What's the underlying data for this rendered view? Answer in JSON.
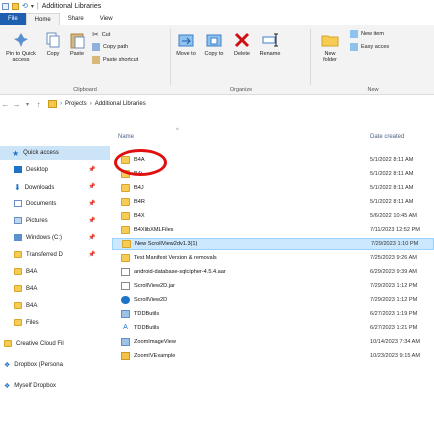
{
  "window": {
    "title": "Additional Libraries"
  },
  "ribbon_tabs": [
    "File",
    "Home",
    "Share",
    "View"
  ],
  "ribbon": {
    "clipboard": {
      "label": "Clipboard",
      "pin_to_quick_access": "Pin to Quick access",
      "copy": "Copy",
      "paste": "Paste",
      "cut": "Cut",
      "copy_path": "Copy path",
      "paste_shortcut": "Paste shortcut"
    },
    "organize": {
      "label": "Organize",
      "move_to": "Move to",
      "copy_to": "Copy to",
      "delete": "Delete",
      "rename": "Rename"
    },
    "new": {
      "label": "New",
      "new_folder": "New folder",
      "new_item": "New item",
      "easy_access": "Easy acces"
    }
  },
  "address": {
    "crumbs": [
      "Projects",
      "Additional Libraries"
    ]
  },
  "nav": [
    {
      "label": "Quick access",
      "icon": "star-icon",
      "color": "#1e73c8"
    },
    {
      "label": "Desktop",
      "icon": "desktop-icon",
      "color": "#1e73c8"
    },
    {
      "label": "Downloads",
      "icon": "download-icon",
      "color": "#1e73c8"
    },
    {
      "label": "Documents",
      "icon": "document-icon",
      "color": "#6b8fbf"
    },
    {
      "label": "Pictures",
      "icon": "picture-icon",
      "color": "#6b8fbf"
    },
    {
      "label": "Windows (C:)",
      "icon": "drive-icon",
      "color": "#5a8fd0"
    },
    {
      "label": "Transferred D",
      "icon": "folder-icon",
      "color": "#f6cc55"
    },
    {
      "label": "B4A",
      "icon": "folder-icon",
      "color": "#f6cc55"
    },
    {
      "label": "B4A",
      "icon": "folder-icon",
      "color": "#f6cc55"
    },
    {
      "label": "B4A",
      "icon": "folder-icon",
      "color": "#f6cc55"
    },
    {
      "label": "Files",
      "icon": "folder-icon",
      "color": "#f6cc55"
    },
    {
      "label": "Creative Cloud Fil",
      "icon": "folder-icon",
      "color": "#f6cc55"
    },
    {
      "label": "Dropbox (Persona",
      "icon": "dropbox-icon",
      "color": "#1e73c8"
    },
    {
      "label": "Myself Dropbox",
      "icon": "dropbox-icon",
      "color": "#1e73c8"
    }
  ],
  "columns": {
    "name": "Name",
    "date_created": "Date created"
  },
  "files": [
    {
      "name": "B4A",
      "date": "5/1/2022 8:11 AM",
      "type": "folder"
    },
    {
      "name": "B4i",
      "date": "5/1/2022 8:11 AM",
      "type": "folder"
    },
    {
      "name": "B4J",
      "date": "5/1/2022 8:11 AM",
      "type": "folder"
    },
    {
      "name": "B4R",
      "date": "5/1/2022 8:11 AM",
      "type": "folder"
    },
    {
      "name": "B4X",
      "date": "5/6/2022 10:45 AM",
      "type": "folder"
    },
    {
      "name": "B4XlibXMLFiles",
      "date": "7/11/2023 12:52 PM",
      "type": "folder"
    },
    {
      "name": "New ScrollView2dv1.3(1)",
      "date": "7/29/2023 1:10 PM",
      "type": "folder"
    },
    {
      "name": "Test Manifest Version & removals",
      "date": "7/25/2023 9:26 AM",
      "type": "folder"
    },
    {
      "name": "android-database-sqlcipher-4.5.4.aar",
      "date": "6/29/2023 9:39 AM",
      "type": "doc"
    },
    {
      "name": "ScrollView2D.jar",
      "date": "7/29/2023 1:12 PM",
      "type": "doc"
    },
    {
      "name": "ScrollView2D",
      "date": "7/29/2023 1:12 PM",
      "type": "globe"
    },
    {
      "name": "TDDButils",
      "date": "6/27/2023 1:19 PM",
      "type": "lib"
    },
    {
      "name": "TDDButils",
      "date": "6/27/2023 1:21 PM",
      "type": "text"
    },
    {
      "name": "ZoomImageView",
      "date": "10/14/2023 7:34 AM",
      "type": "lib"
    },
    {
      "name": "ZoomIVExample",
      "date": "10/23/2023 9:15 AM",
      "type": "zip"
    }
  ]
}
